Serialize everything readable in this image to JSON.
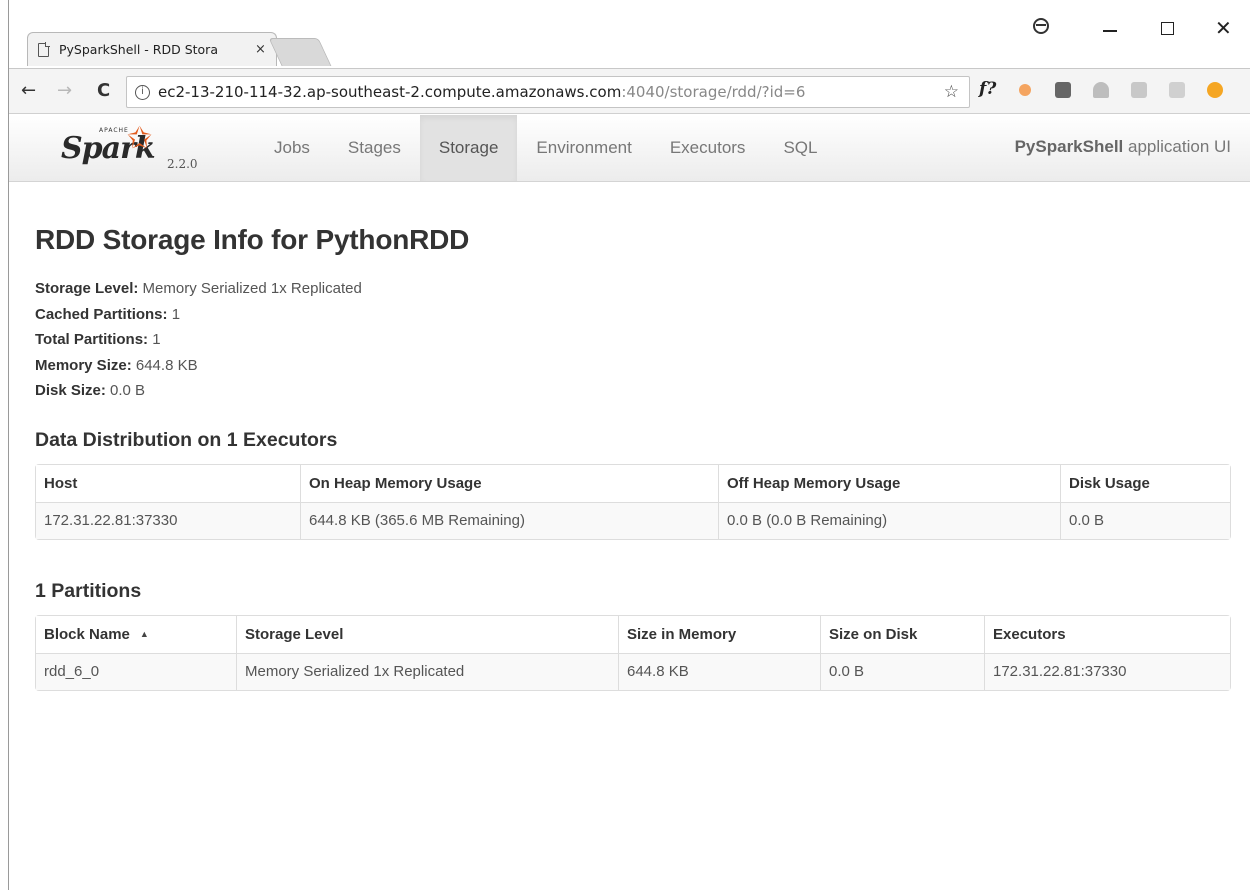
{
  "browser": {
    "tab_title": "PySparkShell - RDD Stora",
    "tab_close": "×",
    "url_host": "ec2-13-210-114-32.ap-southeast-2.compute.amazonaws.com",
    "url_rest": ":4040/storage/rdd/?id=6",
    "nav": {
      "back": "←",
      "forward": "→",
      "reload": "C"
    },
    "star": "☆",
    "ext_f": "f?"
  },
  "navbar": {
    "logo_apache": "APACHE",
    "logo_text": "Spark",
    "version": "2.2.0",
    "links": [
      "Jobs",
      "Stages",
      "Storage",
      "Environment",
      "Executors",
      "SQL"
    ],
    "active_link": "Storage",
    "app_name_bold": "PySparkShell",
    "app_name_rest": " application UI"
  },
  "page": {
    "title": "RDD Storage Info for PythonRDD",
    "summary": [
      {
        "label": "Storage Level:",
        "value": " Memory Serialized 1x Replicated"
      },
      {
        "label": "Cached Partitions:",
        "value": " 1"
      },
      {
        "label": "Total Partitions:",
        "value": " 1"
      },
      {
        "label": "Memory Size:",
        "value": " 644.8 KB"
      },
      {
        "label": "Disk Size:",
        "value": " 0.0 B"
      }
    ]
  },
  "distribution": {
    "title": "Data Distribution on 1 Executors",
    "columns": [
      "Host",
      "On Heap Memory Usage",
      "Off Heap Memory Usage",
      "Disk Usage"
    ],
    "rows": [
      [
        "172.31.22.81:37330",
        "644.8 KB (365.6 MB Remaining)",
        "0.0 B (0.0 B Remaining)",
        "0.0 B"
      ]
    ]
  },
  "partitions": {
    "title": "1 Partitions",
    "columns": [
      "Block Name",
      "Storage Level",
      "Size in Memory",
      "Size on Disk",
      "Executors"
    ],
    "sort_indicator": "▲",
    "rows": [
      [
        "rdd_6_0",
        "Memory Serialized 1x Replicated",
        "644.8 KB",
        "0.0 B",
        "172.31.22.81:37330"
      ]
    ]
  },
  "colors": {
    "spark_orange": "#e25a1c",
    "active_tab_bg": "#e2e2e2"
  }
}
